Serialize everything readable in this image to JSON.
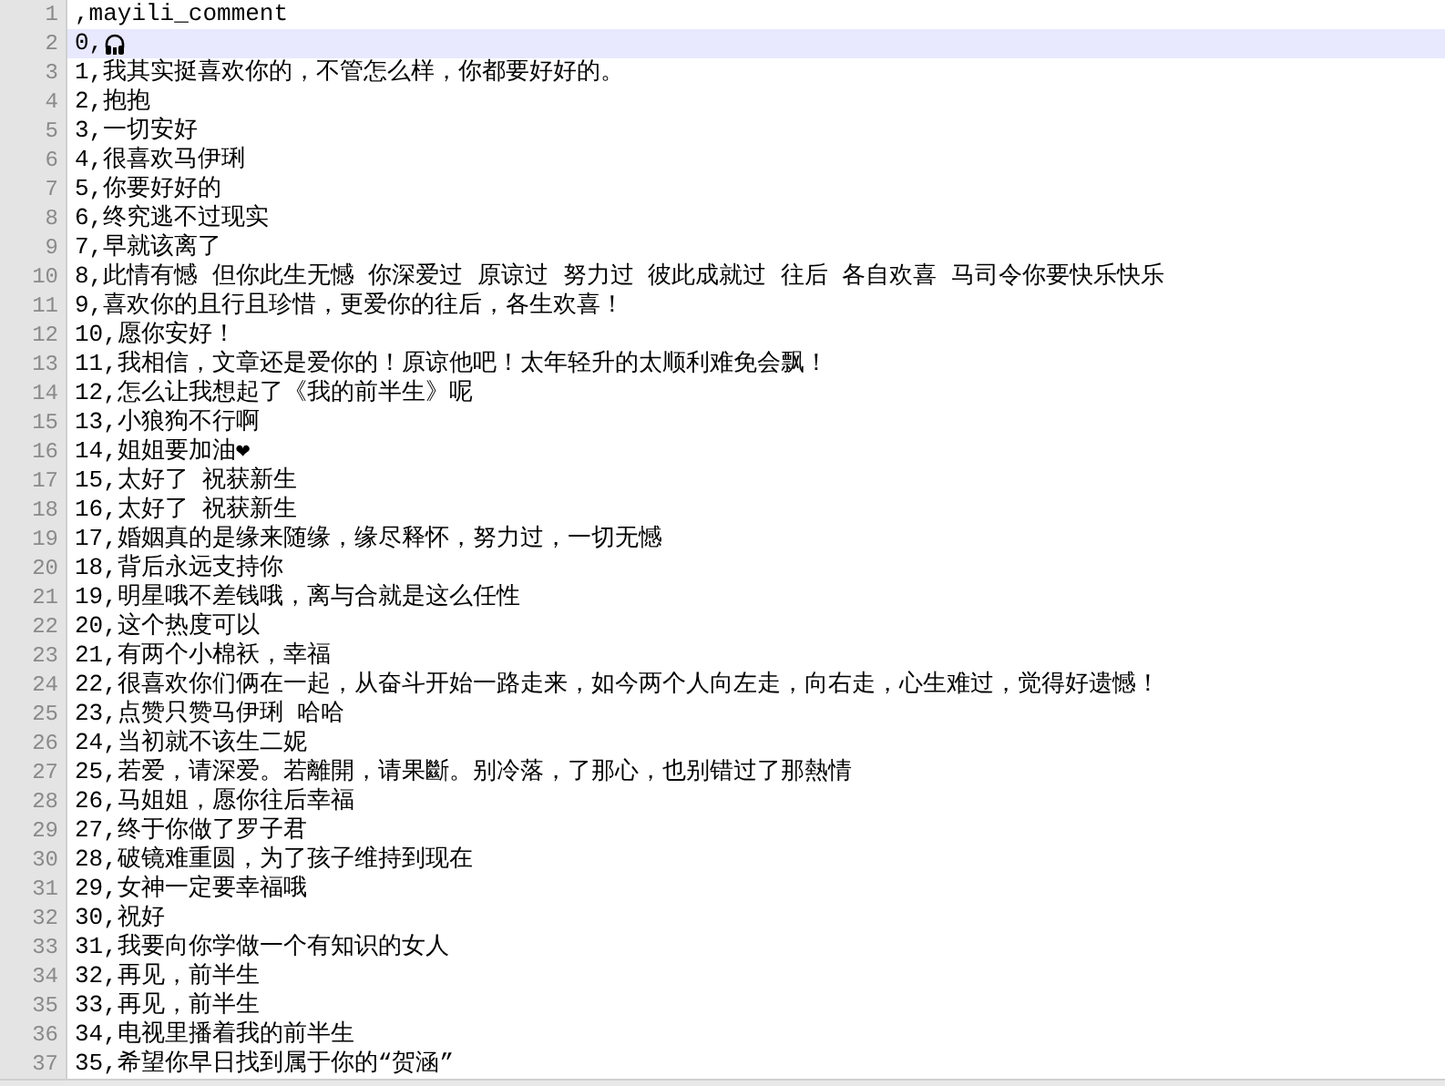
{
  "editor": {
    "lines": [
      {
        "number": "1",
        "text": ",mayili_comment",
        "kind": "text",
        "current": false
      },
      {
        "number": "2",
        "text": "0,",
        "kind": "emoji",
        "current": true
      },
      {
        "number": "3",
        "text": "1,我其实挺喜欢你的，不管怎么样，你都要好好的。",
        "kind": "text",
        "current": false
      },
      {
        "number": "4",
        "text": "2,抱抱",
        "kind": "text",
        "current": false
      },
      {
        "number": "5",
        "text": "3,一切安好",
        "kind": "text",
        "current": false
      },
      {
        "number": "6",
        "text": "4,很喜欢马伊琍",
        "kind": "text",
        "current": false
      },
      {
        "number": "7",
        "text": "5,你要好好的",
        "kind": "text",
        "current": false
      },
      {
        "number": "8",
        "text": "6,终究逃不过现实",
        "kind": "text",
        "current": false
      },
      {
        "number": "9",
        "text": "7,早就该离了",
        "kind": "text",
        "current": false
      },
      {
        "number": "10",
        "text": "8,此情有憾 但你此生无憾 你深爱过 原谅过 努力过 彼此成就过 往后 各自欢喜 马司令你要快乐快乐",
        "kind": "text",
        "current": false
      },
      {
        "number": "11",
        "text": "9,喜欢你的且行且珍惜，更爱你的往后，各生欢喜！",
        "kind": "text",
        "current": false
      },
      {
        "number": "12",
        "text": "10,愿你安好！",
        "kind": "text",
        "current": false
      },
      {
        "number": "13",
        "text": "11,我相信，文章还是爱你的！原谅他吧！太年轻升的太顺利难免会飘！",
        "kind": "text",
        "current": false
      },
      {
        "number": "14",
        "text": "12,怎么让我想起了《我的前半生》呢",
        "kind": "text",
        "current": false
      },
      {
        "number": "15",
        "text": "13,小狼狗不行啊",
        "kind": "text",
        "current": false
      },
      {
        "number": "16",
        "text": "14,姐姐要加油❤",
        "kind": "text",
        "current": false
      },
      {
        "number": "17",
        "text": "15,太好了 祝获新生",
        "kind": "text",
        "current": false
      },
      {
        "number": "18",
        "text": "16,太好了 祝获新生",
        "kind": "text",
        "current": false
      },
      {
        "number": "19",
        "text": "17,婚姻真的是缘来随缘，缘尽释怀，努力过，一切无憾",
        "kind": "text",
        "current": false
      },
      {
        "number": "20",
        "text": "18,背后永远支持你",
        "kind": "text",
        "current": false
      },
      {
        "number": "21",
        "text": "19,明星哦不差钱哦，离与合就是这么任性",
        "kind": "text",
        "current": false
      },
      {
        "number": "22",
        "text": "20,这个热度可以",
        "kind": "text",
        "current": false
      },
      {
        "number": "23",
        "text": "21,有两个小棉袄，幸福",
        "kind": "text",
        "current": false
      },
      {
        "number": "24",
        "text": "22,很喜欢你们俩在一起，从奋斗开始一路走来，如今两个人向左走，向右走，心生难过，觉得好遗憾！",
        "kind": "text",
        "current": false
      },
      {
        "number": "25",
        "text": "23,点赞只赞马伊琍 哈哈",
        "kind": "text",
        "current": false
      },
      {
        "number": "26",
        "text": "24,当初就不该生二妮",
        "kind": "text",
        "current": false
      },
      {
        "number": "27",
        "text": "25,若爱，请深爱。若離開，请果斷。别冷落，了那心，也别错过了那熱情",
        "kind": "text",
        "current": false
      },
      {
        "number": "28",
        "text": "26,马姐姐，愿你往后幸福",
        "kind": "text",
        "current": false
      },
      {
        "number": "29",
        "text": "27,终于你做了罗子君",
        "kind": "text",
        "current": false
      },
      {
        "number": "30",
        "text": "28,破镜难重圆，为了孩子维持到现在",
        "kind": "text",
        "current": false
      },
      {
        "number": "31",
        "text": "29,女神一定要幸福哦",
        "kind": "text",
        "current": false
      },
      {
        "number": "32",
        "text": "30,祝好",
        "kind": "text",
        "current": false
      },
      {
        "number": "33",
        "text": "31,我要向你学做一个有知识的女人",
        "kind": "text",
        "current": false
      },
      {
        "number": "34",
        "text": "32,再见，前半生",
        "kind": "text",
        "current": false
      },
      {
        "number": "35",
        "text": "33,再见，前半生",
        "kind": "text",
        "current": false
      },
      {
        "number": "36",
        "text": "34,电视里播着我的前半生",
        "kind": "text",
        "current": false
      },
      {
        "number": "37",
        "text": "35,希望你早日找到属于你的“贺涵”",
        "kind": "text",
        "current": false
      }
    ]
  }
}
